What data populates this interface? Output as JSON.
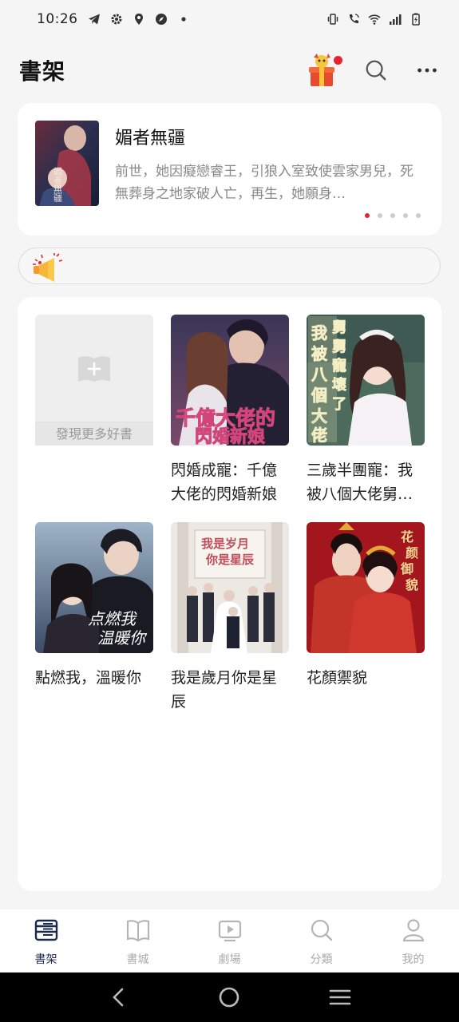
{
  "status_bar": {
    "time": "10:26"
  },
  "header": {
    "title": "書架"
  },
  "banner": {
    "title": "媚者無疆",
    "description": "前世，她因癡戀睿王，引狼入室致使雲家男兒，死無葬身之地家破人亡，再生，她願身…",
    "page_count": 5,
    "active_page": 0,
    "cover_text": "媚者無疆"
  },
  "shelf": {
    "add_label": "發現更多好書",
    "books": [
      {
        "title": "閃婚成寵：千億大佬的閃婚新娘",
        "cover_text": "千億大佬的\n閃婚新娘"
      },
      {
        "title": "三歲半團寵：我被八個大佬舅…",
        "cover_text": "我被八個大佬舅舅寵壞了"
      },
      {
        "title": "點燃我，溫暖你",
        "cover_text": "点燃我\n温暖你"
      },
      {
        "title": "我是歲月你是星辰",
        "cover_text": "我是岁月\n你是星辰"
      },
      {
        "title": "花顏禦貌",
        "cover_text": "花颜御貌"
      }
    ]
  },
  "bottom_nav": {
    "items": [
      {
        "label": "書架",
        "active": true
      },
      {
        "label": "書城",
        "active": false
      },
      {
        "label": "劇場",
        "active": false
      },
      {
        "label": "分類",
        "active": false
      },
      {
        "label": "我的",
        "active": false
      }
    ]
  },
  "colors": {
    "accent": "#e8232f",
    "nav_active": "#1b2a4a",
    "nav_inactive": "#aaaaaa"
  }
}
